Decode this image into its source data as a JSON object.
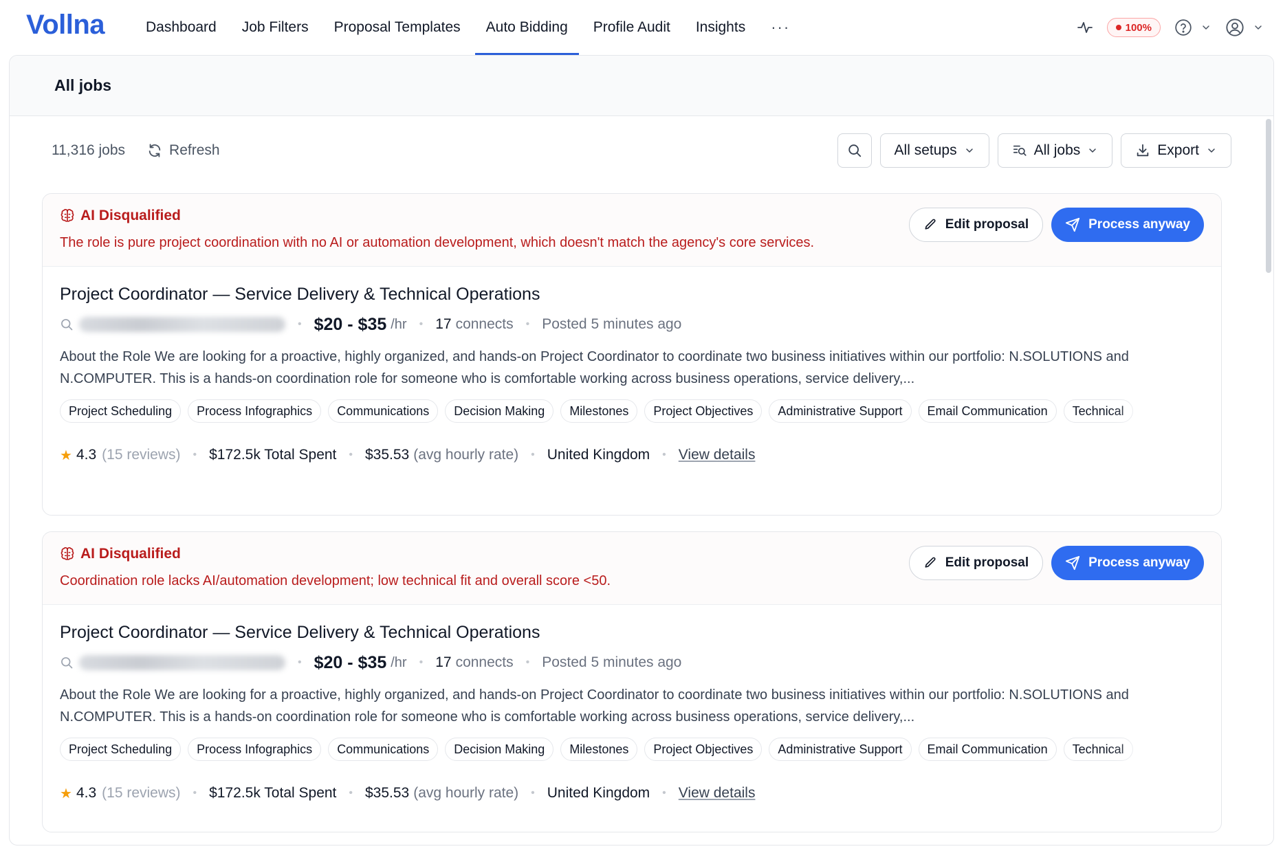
{
  "app": {
    "logo": "Vollna",
    "brand_color": "#2b5fd9"
  },
  "nav": {
    "tabs": [
      {
        "label": "Dashboard"
      },
      {
        "label": "Job Filters"
      },
      {
        "label": "Proposal Templates"
      },
      {
        "label": "Auto Bidding",
        "active": true
      },
      {
        "label": "Profile Audit"
      },
      {
        "label": "Insights"
      }
    ],
    "more_label": "···",
    "quota_badge": "100%"
  },
  "panel": {
    "title": "All jobs"
  },
  "toolbar": {
    "job_count": "11,316 jobs",
    "refresh_label": "Refresh",
    "setups_label": "All setups",
    "filter_label": "All jobs",
    "export_label": "Export"
  },
  "jobs": [
    {
      "status": "AI Disqualified",
      "reason": "The role is pure project coordination with no AI or automation development, which doesn't match the agency's core services.",
      "edit_label": "Edit proposal",
      "process_label": "Process anyway",
      "title": "Project Coordinator — Service Delivery & Technical Operations",
      "rate": "$20 - $35",
      "rate_unit": "/hr",
      "connects_count": "17",
      "connects_label": "connects",
      "posted": "Posted 5 minutes ago",
      "description": "About the Role We are looking for a proactive, highly organized, and hands-on Project Coordinator to coordinate two business initiatives within our portfolio: N.SOLUTIONS and N.COMPUTER. This is a hands-on coordination role for someone who is comfortable working across business operations, service delivery,...",
      "tags": [
        "Project Scheduling",
        "Process Infographics",
        "Communications",
        "Decision Making",
        "Milestones",
        "Project Objectives",
        "Administrative Support",
        "Email Communication",
        "Technical"
      ],
      "rating": "4.3",
      "reviews": "(15 reviews)",
      "total_spent": "$172.5k Total Spent",
      "avg_rate": "$35.53",
      "avg_rate_label": "(avg hourly rate)",
      "country": "United Kingdom",
      "details_label": "View details"
    },
    {
      "status": "AI Disqualified",
      "reason": "Coordination role lacks AI/automation development; low technical fit and overall score <50.",
      "edit_label": "Edit proposal",
      "process_label": "Process anyway",
      "title": "Project Coordinator — Service Delivery & Technical Operations",
      "rate": "$20 - $35",
      "rate_unit": "/hr",
      "connects_count": "17",
      "connects_label": "connects",
      "posted": "Posted 5 minutes ago",
      "description": "About the Role We are looking for a proactive, highly organized, and hands-on Project Coordinator to coordinate two business initiatives within our portfolio: N.SOLUTIONS and N.COMPUTER. This is a hands-on coordination role for someone who is comfortable working across business operations, service delivery,...",
      "tags": [
        "Project Scheduling",
        "Process Infographics",
        "Communications",
        "Decision Making",
        "Milestones",
        "Project Objectives",
        "Administrative Support",
        "Email Communication",
        "Technical"
      ],
      "rating": "4.3",
      "reviews": "(15 reviews)",
      "total_spent": "$172.5k Total Spent",
      "avg_rate": "$35.53",
      "avg_rate_label": "(avg hourly rate)",
      "country": "United Kingdom",
      "details_label": "View details"
    }
  ]
}
